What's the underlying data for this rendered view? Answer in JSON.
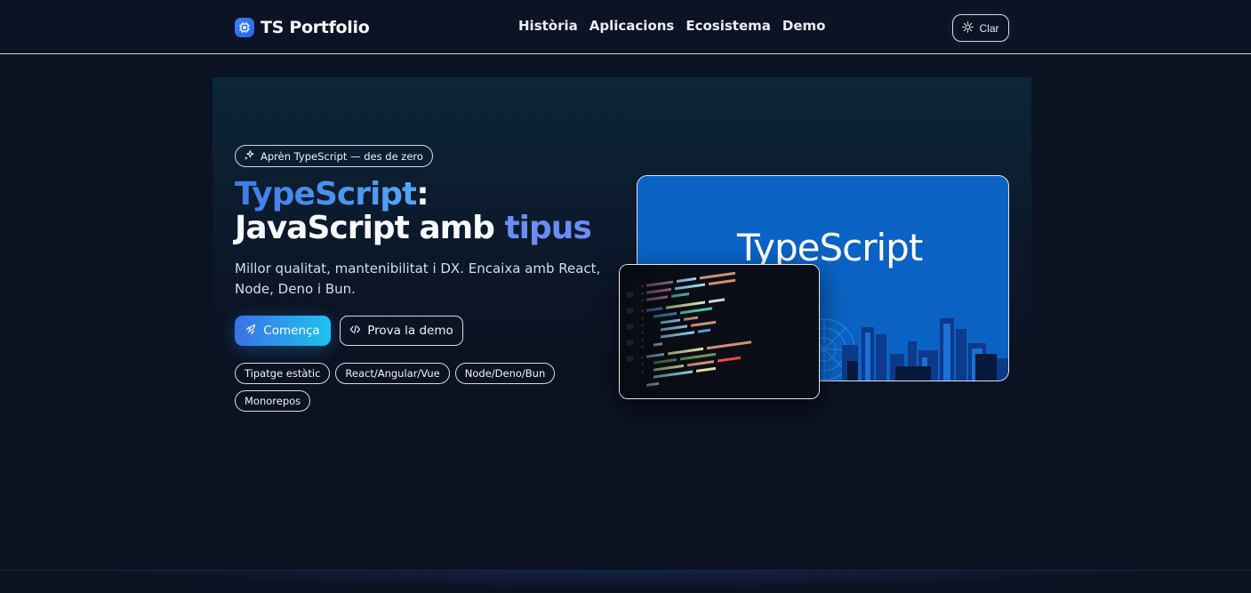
{
  "header": {
    "brand": "TS Portfolio",
    "nav": [
      "Història",
      "Aplicacions",
      "Ecosistema",
      "Demo"
    ],
    "theme_label": "Clar"
  },
  "hero": {
    "badge": "Aprèn TypeScript — des de zero",
    "title_part1": "TypeScript",
    "title_colon": ":",
    "title_part2": "JavaScript amb ",
    "title_part3": "tipus",
    "lead": "Millor qualitat, mantenibilitat i DX. Encaixa amb React, Node, Deno i Bun.",
    "primary_cta": "Comença",
    "secondary_cta": "Prova la demo",
    "tags": [
      "Tipatge estàtic",
      "React/Angular/Vue",
      "Node/Deno/Bun",
      "Monorepos"
    ]
  },
  "media": {
    "logo_text": "TypeScript"
  },
  "colors": {
    "background": "#0b1222",
    "accent_blue": "#3b72e4",
    "accent_cyan": "#1cc3f0",
    "ts_blue": "#0a63c4"
  }
}
